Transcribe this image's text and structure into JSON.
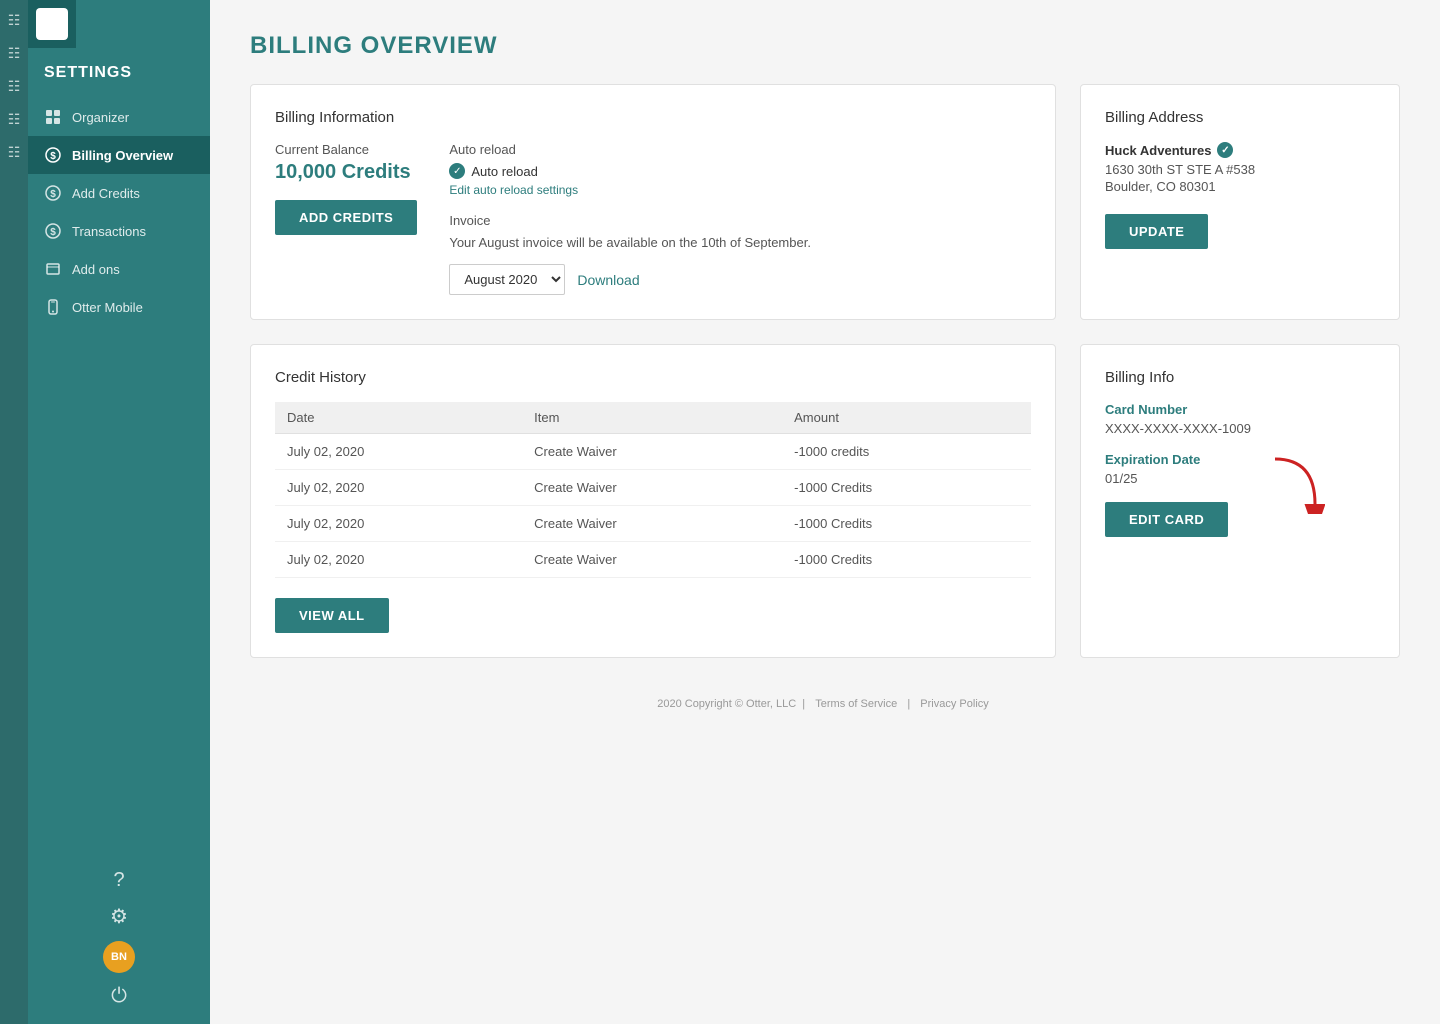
{
  "sidebar": {
    "title": "SETTINGS",
    "logo_alt": "Otter Logo",
    "items": [
      {
        "id": "organizer",
        "label": "Organizer",
        "icon": "grid"
      },
      {
        "id": "billing-overview",
        "label": "Billing Overview",
        "icon": "dollar",
        "active": true
      },
      {
        "id": "add-credits",
        "label": "Add Credits",
        "icon": "dollar"
      },
      {
        "id": "transactions",
        "label": "Transactions",
        "icon": "dollar"
      },
      {
        "id": "add-ons",
        "label": "Add ons",
        "icon": "file"
      },
      {
        "id": "otter-mobile",
        "label": "Otter Mobile",
        "icon": "mobile"
      }
    ],
    "bottom_icons": [
      "question",
      "gear",
      "avatar",
      "power"
    ]
  },
  "page": {
    "title": "BILLING OVERVIEW"
  },
  "billing_info_card": {
    "title": "Billing Information",
    "current_balance_label": "Current Balance",
    "current_balance_value": "10,000 Credits",
    "add_credits_btn": "Add Credits",
    "auto_reload_label": "Auto reload",
    "auto_reload_text": "Auto reload",
    "edit_auto_reload_link": "Edit auto reload settings",
    "invoice_label": "Invoice",
    "invoice_text": "Your August invoice will be available on the 10th of September.",
    "invoice_month_select": "August 2020",
    "download_link": "Download"
  },
  "billing_address_card": {
    "title": "Billing Address",
    "company_name": "Huck Adventures",
    "address_line1": "1630 30th ST STE A #538",
    "address_line2": "Boulder, CO 80301",
    "update_btn": "UPDATE"
  },
  "credit_history_card": {
    "title": "Credit History",
    "columns": [
      "Date",
      "Item",
      "Amount"
    ],
    "rows": [
      {
        "date": "July 02, 2020",
        "item": "Create Waiver",
        "amount": "-1000 credits"
      },
      {
        "date": "July 02, 2020",
        "item": "Create Waiver",
        "amount": "-1000 Credits"
      },
      {
        "date": "July 02, 2020",
        "item": "Create Waiver",
        "amount": "-1000 Credits"
      },
      {
        "date": "July 02, 2020",
        "item": "Create Waiver",
        "amount": "-1000 Credits"
      }
    ],
    "view_all_btn": "VIEW ALL"
  },
  "billing_info_small_card": {
    "title": "Billing Info",
    "card_number_label": "Card Number",
    "card_number_value": "XXXX-XXXX-XXXX-1009",
    "expiration_label": "Expiration Date",
    "expiration_value": "01/25",
    "edit_card_btn": "EDIT CARD"
  },
  "footer": {
    "copyright": "2020 Copyright © Otter, LLC",
    "terms": "Terms of Service",
    "privacy": "Privacy Policy"
  },
  "avatar": {
    "initials": "BN"
  }
}
